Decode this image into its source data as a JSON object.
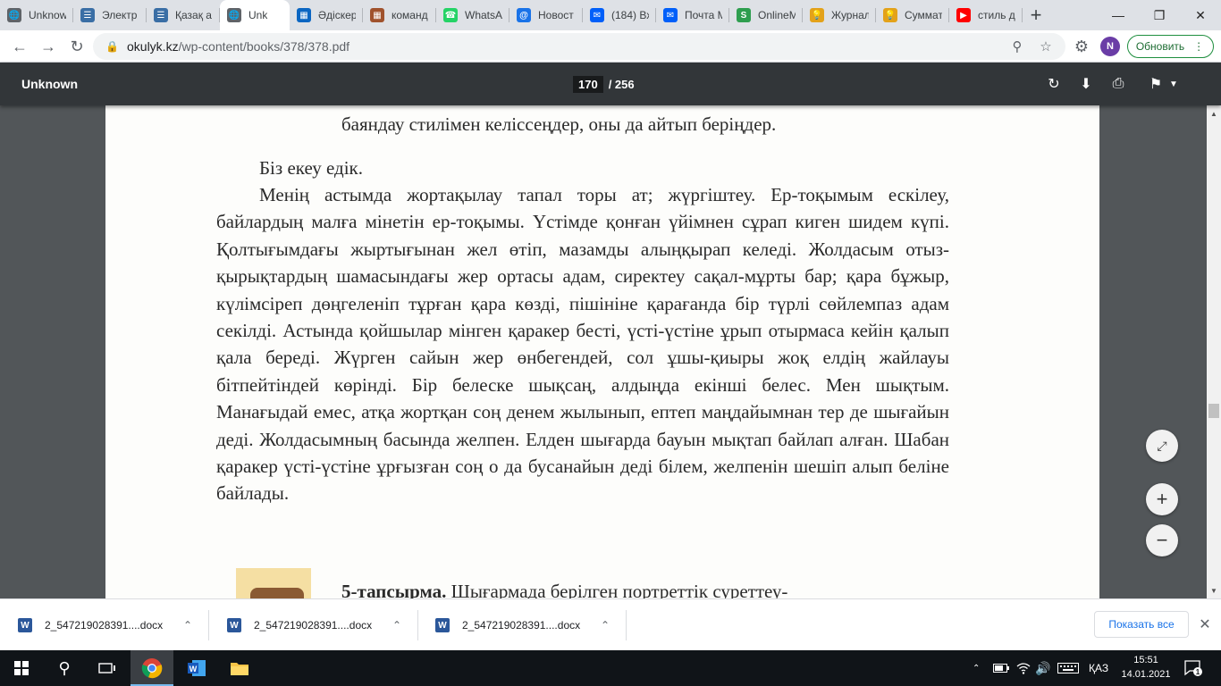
{
  "browser": {
    "tabs": [
      {
        "label": "Unknow",
        "icon": "globe-icon",
        "color": "#5f6368"
      },
      {
        "label": "Электр",
        "icon": "books-icon",
        "color": "#3a6ea5"
      },
      {
        "label": "Қазақ а",
        "icon": "books-icon",
        "color": "#3a6ea5"
      },
      {
        "label": "Unk",
        "icon": "globe-icon",
        "color": "#5f6368",
        "active": true
      },
      {
        "label": "Әдіскер",
        "icon": "trello-icon",
        "color": "#0b66c2"
      },
      {
        "label": "команд",
        "icon": "trello-icon",
        "color": "#a0522d"
      },
      {
        "label": "WhatsA",
        "icon": "whatsapp-icon",
        "color": "#25d366"
      },
      {
        "label": "Новост",
        "icon": "at-icon",
        "color": "#1a73e8"
      },
      {
        "label": "(184) Вх",
        "icon": "mail-icon",
        "color": "#005ff9"
      },
      {
        "label": "Почта М",
        "icon": "mail-icon",
        "color": "#005ff9"
      },
      {
        "label": "OnlineM",
        "icon": "s-icon",
        "color": "#2e9e4f"
      },
      {
        "label": "Журнал",
        "icon": "bulb-icon",
        "color": "#e3a21a"
      },
      {
        "label": "Суммат",
        "icon": "bulb-icon",
        "color": "#e3a21a"
      },
      {
        "label": "стиль д",
        "icon": "youtube-icon",
        "color": "#ff0000"
      }
    ],
    "new_tab": "+",
    "url_host": "okulyk.kz",
    "url_path": "/wp-content/books/378/378.pdf",
    "profile_initial": "N",
    "update_label": "Обновить"
  },
  "pdf": {
    "title": "Unknown",
    "current_page": "170",
    "total_pages": "/ 256"
  },
  "page": {
    "line_top": "баяндау стилімен келіссеңдер, оны да айтып беріңдер.",
    "line_biz": "Біз екеу едік.",
    "paragraph": "Менің астымда жортақылау тапал торы ат; жүргіштеу. Ер-тоқымым ескілеу, байлардың малға мінетін ер-тоқымы. Үстімде қонған үйімнен сұрап киген шидем күпі. Қолтығымдағы жыртығынан жел өтіп, мазамды алыңқырап келеді. Жолдасым отыз-қырықтардың шамасындағы жер ортасы адам, сиректеу сақал-мұрты бар; қара бұжыр, күлімсіреп дөңгеленіп тұрған қара көзді, пішініне қарағанда бір түрлі сөйлемпаз адам секілді. Астында қойшылар мінген қаракер бесті, үсті-үстіне ұрып отырмаса кейін қалып қала береді. Жүрген сайын жер өнбегендей, сол ұшы-қиыры жоқ елдің жайлауы бітпейтіндей көрінді. Бір белеске шықсаң, алдыңда екінші белес. Мен шықтым. Манағыдай емес, атқа жортқан соң денем жылынып, ептеп маңдайымнан тер де шығайын деді. Жолдасымның басында желпен. Елден шығарда бауын мықтап байлап алған. Шабан қаракер үсті-үстіне ұрғызған соң о да бусанайын деді білем, желпенін шешіп алып беліне байлады.",
    "task_label": "5-тапсырма.",
    "task_text": " Шығармада берілген портреттік суреттеу-"
  },
  "downloads": {
    "items": [
      "2_547219028391....docx",
      "2_547219028391....docx",
      "2_547219028391....docx"
    ],
    "show_all": "Показать все"
  },
  "taskbar": {
    "lang": "ҚАЗ",
    "time": "15:51",
    "date": "14.01.2021",
    "notifications": "1"
  }
}
